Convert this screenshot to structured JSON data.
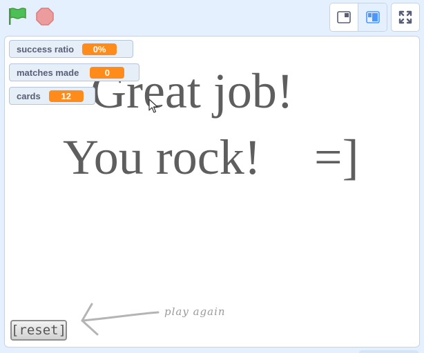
{
  "controls": {
    "green_flag_icon": "green-flag-icon",
    "stop_icon": "stop-sign-icon",
    "small_stage_icon": "small-stage-layout-icon",
    "normal_stage_icon": "normal-stage-layout-icon",
    "fullscreen_icon": "fullscreen-icon"
  },
  "monitors": [
    {
      "label": "success ratio",
      "value": "0%"
    },
    {
      "label": "matches made",
      "value": "0"
    },
    {
      "label": "cards",
      "value": "12"
    }
  ],
  "stage": {
    "line1": "Great job!",
    "line2": "You rock!",
    "smiley": "=]",
    "hint": "play again",
    "reset_label": "[reset]"
  },
  "colors": {
    "monitor_value_bg": "#ff8c1a",
    "stage_text": "#5e5e5e",
    "flag_green": "#4cbf56",
    "stop_red": "#ec9c9c"
  }
}
